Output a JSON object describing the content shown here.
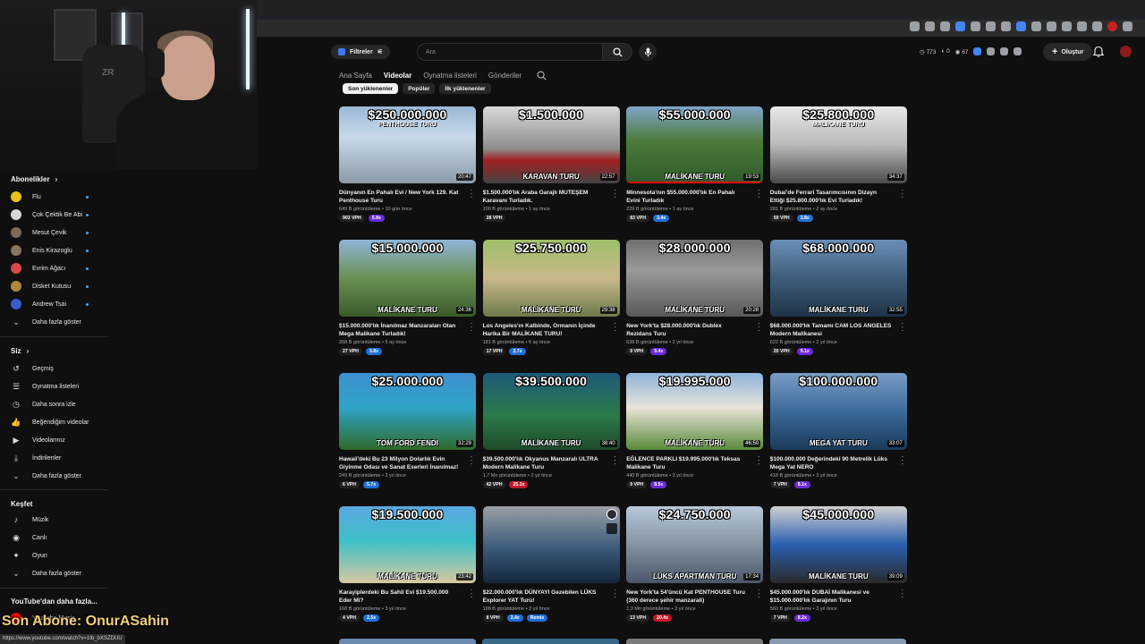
{
  "browser": {
    "counters": {
      "a": "773",
      "b": "0",
      "c": "67"
    }
  },
  "header": {
    "filters_label": "Filtreler",
    "search_placeholder": "Ara",
    "create_label": "Oluştur"
  },
  "channel_tabs": [
    "Ana Sayfa",
    "Videolar",
    "Oynatma listeleri",
    "Gönderiler"
  ],
  "active_tab": "Videolar",
  "chips": [
    "Son yüklenenler",
    "Popüler",
    "İlk yüklenenler"
  ],
  "sidebar": {
    "subscriptions_title": "Abonelikler",
    "subscriptions": [
      {
        "label": "Flu",
        "color": "#e8c21a"
      },
      {
        "label": "Çok Çektik Be Abi",
        "color": "#d7d7d7"
      },
      {
        "label": "Mesut Çevik",
        "color": "#7a6a5a"
      },
      {
        "label": "Enis Kirazoglu",
        "color": "#8a7660"
      },
      {
        "label": "Evrim Ağacı",
        "color": "#d84a4a"
      },
      {
        "label": "Disket Kutusu",
        "color": "#b08a3a"
      },
      {
        "label": "Andrew Tsai",
        "color": "#3a5ad0"
      }
    ],
    "subs_more": "Daha fazla göster",
    "you_title": "Siz",
    "you_items": [
      {
        "label": "Geçmiş",
        "icon": "history-icon"
      },
      {
        "label": "Oynatma listeleri",
        "icon": "playlists-icon"
      },
      {
        "label": "Daha sonra izle",
        "icon": "watch-later-icon"
      },
      {
        "label": "Beğendiğim videolar",
        "icon": "like-icon"
      },
      {
        "label": "Videolarınız",
        "icon": "your-videos-icon"
      },
      {
        "label": "İndirilenler",
        "icon": "download-icon"
      }
    ],
    "you_more": "Daha fazla göster",
    "explore_title": "Keşfet",
    "explore_items": [
      {
        "label": "Müzik",
        "icon": "music-icon"
      },
      {
        "label": "Canlı",
        "icon": "live-icon"
      },
      {
        "label": "Oyun",
        "icon": "gaming-icon"
      }
    ],
    "explore_more": "Daha fazla göster",
    "more_yt_title": "YouTube'dan daha fazla...",
    "more_yt_items": [
      "YouTube Music"
    ]
  },
  "overlay_text": "Son Abone: OnurASahin",
  "status_url": "https://www.youtube.com/watch?v=1Ib_bXSZDUU",
  "videos": [
    {
      "price": "$250.000.000",
      "sub": "PENTHOUSE TURU",
      "tag": "",
      "duration": "20:47",
      "title": "Dünyanın En Pahalı Evi / New York 129. Kat Penthouse Turu",
      "meta": "649 B görüntüleme • 10 gün önce",
      "vph": "903 VPH",
      "mult": "5.8x",
      "mult_color": "#6c2bd9",
      "bg": "linear-gradient(180deg,#9bb8d6 0%,#c9d9ea 40%,#8c9aa8 100%)",
      "progress": 0
    },
    {
      "price": "$1.500.000",
      "sub": "",
      "tag": "KARAVAN TURU",
      "duration": "22:57",
      "title": "$1.500.000'lık Araba Garajlı MUTEŞEM Karavanı Turladık.",
      "meta": "100 B görüntüleme • 1 ay önce",
      "vph": "28 VPH",
      "mult": "",
      "mult_color": "",
      "bg": "linear-gradient(180deg,#d9d9d9 0%,#8d8d8d 55%,#a02020 70%,#444 100%)",
      "progress": 0
    },
    {
      "price": "$55.000.000",
      "sub": "",
      "tag": "MALİKANE TURU",
      "duration": "19:53",
      "title": "Minnesota'nın $55.000.000'lık En Pahalı Evini Turladık",
      "meta": "229 B görüntüleme • 1 ay önce",
      "vph": "83 VPH",
      "mult": "3.4x",
      "mult_color": "#1f6fd6",
      "bg": "linear-gradient(180deg,#7fa6c9 0%,#4d7a3a 45%,#2f5b2a 100%)",
      "progress": 1
    },
    {
      "price": "$25.800.000",
      "sub": "MALİKANE TURU",
      "tag": "",
      "duration": "34:37",
      "title": "Dubai'de Ferrari Tasarımcısının Dizayn Ettiği $25.800.000'lık Evi Turladık!",
      "meta": "281 B görüntüleme • 2 ay önce",
      "vph": "59 VPH",
      "mult": "3.8x",
      "mult_color": "#1f6fd6",
      "bg": "linear-gradient(180deg,#e8e8e8 0%,#b9b9b9 50%,#4a4a4a 100%)",
      "progress": 0
    },
    {
      "price": "$15.000.000",
      "sub": "",
      "tag": "MALİKANE TURU",
      "duration": "24:36",
      "title": "$15.000.000'lık İnanılmaz Manzaraları Olan Mega Malikane Turladık!",
      "meta": "268 B görüntüleme • 5 ay önce",
      "vph": "27 VPH",
      "mult": "3.8x",
      "mult_color": "#1f6fd6",
      "bg": "linear-gradient(180deg,#8fb5d8 0%,#6a8f52 50%,#3b5a2b 100%)",
      "progress": 0
    },
    {
      "price": "$25.750.000",
      "sub": "",
      "tag": "MALİKANE TURU",
      "duration": "29:38",
      "title": "Los Angeles'ın Kalbinde, Ormanın İçinde Harika Bir MALİKANE TURU!",
      "meta": "181 B görüntüleme • 6 ay önce",
      "vph": "17 VPH",
      "mult": "2.7x",
      "mult_color": "#1f6fd6",
      "bg": "linear-gradient(180deg,#9fbf6a 0%,#c9b88a 50%,#6c7a4a 100%)",
      "progress": 0
    },
    {
      "price": "$28.000.000",
      "sub": "",
      "tag": "MALİKANE TURU",
      "duration": "20:28",
      "title": "New York'ta $28.000.000'lık Dublex Rezidans Turu",
      "meta": "638 B görüntüleme • 2 yıl önce",
      "vph": "9 VPH",
      "mult": "9.4x",
      "mult_color": "#6c2bd9",
      "bg": "linear-gradient(180deg,#707070 0%,#9a9a9a 40%,#585858 100%)",
      "progress": 0
    },
    {
      "price": "$68.000.000",
      "sub": "",
      "tag": "MALİKANE TURU",
      "duration": "32:55",
      "title": "$68.000.000'lık Tamamı CAM LOS ANGELES Modern Malikanesi",
      "meta": "622 B görüntüleme • 2 yıl önce",
      "vph": "20 VPH",
      "mult": "9.1x",
      "mult_color": "#6c2bd9",
      "bg": "linear-gradient(180deg,#6a8fb8 0%,#3e5d7a 50%,#1f3347 100%)",
      "progress": 0
    },
    {
      "price": "$25.000.000",
      "sub": "",
      "tag": "TOM FORD  FENDI",
      "duration": "32:29",
      "title": "Hawaii'deki Bu 23 Milyon Dolarlık Evin Giyinme Odası ve Sanat Eserleri İnanılmaz!",
      "meta": "249 B görüntüleme • 2 yıl önce",
      "vph": "6 VPH",
      "mult": "5.7x",
      "mult_color": "#1f6fd6",
      "bg": "linear-gradient(180deg,#3f8fd0 0%,#2fa4c8 45%,#2f6a2a 100%)",
      "progress": 0
    },
    {
      "price": "$39.500.000",
      "sub": "",
      "tag": "MALİKANE TURU",
      "duration": "38:40",
      "title": "$39.500.000'lık Okyanus Manzaralı ULTRA Modern Malikane Turu",
      "meta": "1,7 Mn görüntüleme • 2 yıl önce",
      "vph": "42 VPH",
      "mult": "25.3x",
      "mult_color": "#c01828",
      "bg": "linear-gradient(180deg,#1d5a7a 0%,#2b7a4a 55%,#1f4a2a 100%)",
      "progress": 0
    },
    {
      "price": "$19.995.000",
      "sub": "",
      "tag": "MALİKANE TURU",
      "duration": "46:50",
      "title": "EĞLENCE PARKLI $19.995.000'lık Teksas Malikane Turu",
      "meta": "440 B görüntüleme • 3 yıl önce",
      "vph": "9 VPH",
      "mult": "8.5x",
      "mult_color": "#6c2bd9",
      "bg": "linear-gradient(180deg,#8fb4dc 0%,#e8e3d8 45%,#5a8a3a 100%)",
      "progress": 0
    },
    {
      "price": "$100.000.000",
      "sub": "",
      "tag": "MEGA YAT TURU",
      "duration": "33:07",
      "title": "$100.000.000 Değerindeki 90 Metrelik Lüks Mega Yat NERO",
      "meta": "418 B görüntüleme • 3 yıl önce",
      "vph": "7 VPH",
      "mult": "8.1x",
      "mult_color": "#6c2bd9",
      "bg": "linear-gradient(180deg,#7a9cc6 0%,#3b6a9a 50%,#1a3a5a 100%)",
      "progress": 0
    },
    {
      "price": "$19.500.000",
      "sub": "",
      "tag": "MALİKANE TURU",
      "duration": "23:42",
      "title": "Karayiplerdeki Bu Sahil Evi $19.500.000 Eder Mi?",
      "meta": "168 B görüntüleme • 3 yıl önce",
      "vph": "4 VPH",
      "mult": "2.5x",
      "mult_color": "#1f6fd6",
      "bg": "linear-gradient(180deg,#5aa8e0 0%,#3cc0c8 45%,#d8c8a0 100%)",
      "progress": 0
    },
    {
      "price": "",
      "sub": "",
      "tag": "",
      "duration": "",
      "title": "$22.000.000'lık DÜNYAYI Gezebilen LÜKS Explorer YAT Turu!",
      "meta": "168 B görüntüleme • 3 yıl önce",
      "vph": "8 VPH",
      "mult": "3.4x",
      "mult_color": "#1f6fd6",
      "extra": "Remix",
      "bg": "linear-gradient(180deg,#9a9fa5 0%,#3a5a7a 55%,#14263a 100%)",
      "progress": 0,
      "hover": true
    },
    {
      "price": "$24.750.000",
      "sub": "",
      "tag": "LÜKS APARTMAN TURU",
      "duration": "17:34",
      "title": "New York'ta 54'üncü Kat PENTHOUSE Turu (360 derece şehir manzarali)",
      "meta": "1,3 Mn görüntüleme • 3 yıl önce",
      "vph": "13 VPH",
      "mult": "20.4x",
      "mult_color": "#c01828",
      "bg": "linear-gradient(180deg,#b8c8d8 0%,#8a98a8 45%,#4a5668 100%)",
      "progress": 0
    },
    {
      "price": "$45.000.000",
      "sub": "",
      "tag": "MALİKANE TURU",
      "duration": "39:09",
      "title": "$45.000.000'lık DUBAİ Malikanesi ve $15.000.000'lık Garajının Turu",
      "meta": "560 B görüntüleme • 3 yıl önce",
      "vph": "7 VPH",
      "mult": "8.2x",
      "mult_color": "#6c2bd9",
      "bg": "linear-gradient(180deg,#d0d0d0 0%,#2a5fb0 50%,#2a2a2a 100%)",
      "progress": 0
    }
  ]
}
